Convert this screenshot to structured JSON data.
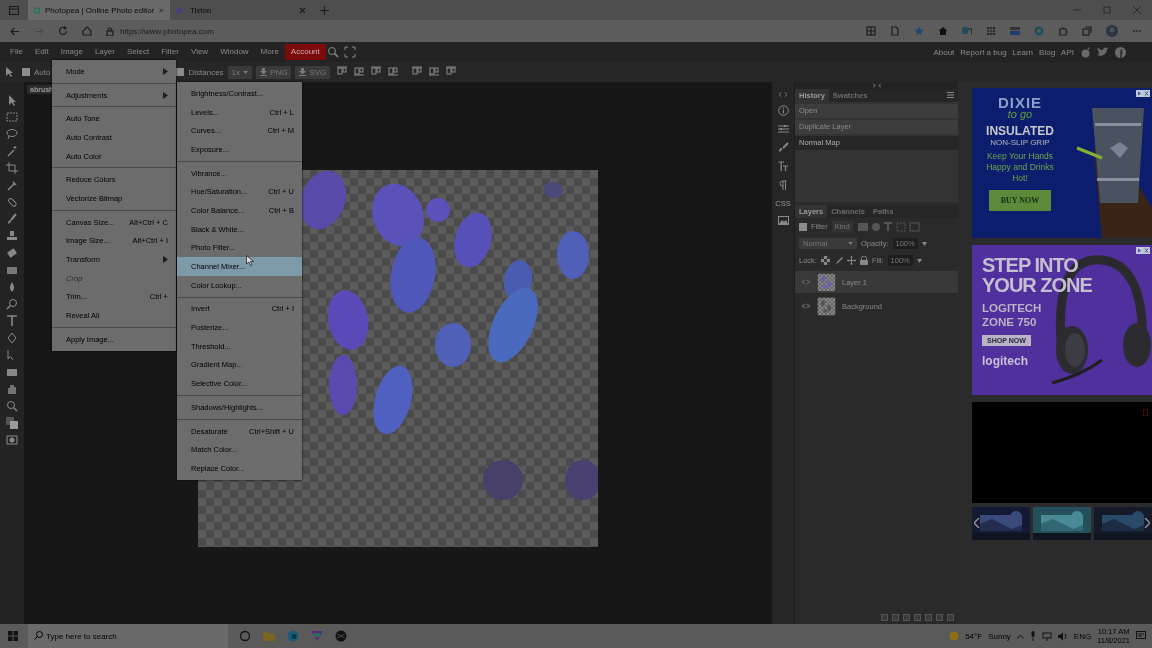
{
  "browser": {
    "tabs": [
      {
        "title": "Photopea | Online Photo editor",
        "selected": true
      },
      {
        "title": "Tixton",
        "selected": false
      }
    ],
    "url": "https://www.photopea.com"
  },
  "menubar": {
    "items": [
      {
        "label": "File",
        "kind": "menu"
      },
      {
        "label": "Edit",
        "kind": "menu"
      },
      {
        "label": "Image",
        "kind": "menu"
      },
      {
        "label": "Layer",
        "kind": "menu"
      },
      {
        "label": "Select",
        "kind": "menu"
      },
      {
        "label": "Filter",
        "kind": "menu"
      },
      {
        "label": "View",
        "kind": "menu"
      },
      {
        "label": "Window",
        "kind": "menu"
      },
      {
        "label": "More",
        "kind": "menu"
      },
      {
        "label": "Account",
        "kind": "account"
      }
    ],
    "links": [
      "About",
      "Report a bug",
      "Learn",
      "Blog",
      "API"
    ]
  },
  "options_bar": {
    "auto_select": {
      "label": "Auto",
      "checked": false
    },
    "distances": {
      "label": "Distances",
      "checked": false
    },
    "scale": "1x",
    "exports": [
      "PNG",
      "SVG"
    ]
  },
  "document_tab": "abrush",
  "image_menu": {
    "groups": [
      [
        {
          "label": "Mode",
          "submenu": true,
          "disabled": false,
          "selected": false
        }
      ],
      [
        {
          "label": "Adjustments",
          "submenu": true,
          "disabled": false,
          "selected": false
        }
      ],
      [
        {
          "label": "Auto Tone",
          "submenu": false,
          "disabled": false,
          "selected": false
        },
        {
          "label": "Auto Contrast",
          "submenu": false,
          "disabled": false,
          "selected": false
        },
        {
          "label": "Auto Color",
          "submenu": false,
          "disabled": false,
          "selected": false
        }
      ],
      [
        {
          "label": "Reduce Colors",
          "submenu": false,
          "disabled": false,
          "selected": false
        },
        {
          "label": "Vectorize Bitmap",
          "submenu": false,
          "disabled": false,
          "selected": false
        }
      ],
      [
        {
          "label": "Canvas Size...",
          "shortcut": "Alt+Ctrl + C",
          "submenu": false,
          "disabled": false,
          "selected": false
        },
        {
          "label": "Image Size...",
          "shortcut": "Alt+Ctrl + I",
          "submenu": false,
          "disabled": false,
          "selected": false
        },
        {
          "label": "Transform",
          "submenu": true,
          "disabled": false,
          "selected": false
        },
        {
          "label": "Crop",
          "submenu": false,
          "disabled": true,
          "selected": false
        },
        {
          "label": "Trim...",
          "shortcut": "Ctrl +",
          "submenu": false,
          "disabled": false,
          "selected": false
        },
        {
          "label": "Reveal All",
          "submenu": false,
          "disabled": false,
          "selected": false
        }
      ],
      [
        {
          "label": "Apply Image...",
          "submenu": false,
          "disabled": false,
          "selected": false
        }
      ]
    ]
  },
  "adjustments_menu": {
    "groups": [
      [
        {
          "label": "Brightness/Contrast...",
          "selected": false
        },
        {
          "label": "Levels...",
          "shortcut": "Ctrl + L",
          "selected": false
        },
        {
          "label": "Curves...",
          "shortcut": "Ctrl + M",
          "selected": false
        },
        {
          "label": "Exposure...",
          "selected": false
        }
      ],
      [
        {
          "label": "Vibrance...",
          "selected": false
        },
        {
          "label": "Hue/Saturation...",
          "shortcut": "Ctrl + U",
          "selected": false
        },
        {
          "label": "Color Balance...",
          "shortcut": "Ctrl + B",
          "selected": false
        },
        {
          "label": "Black & White...",
          "selected": false
        },
        {
          "label": "Photo Filter...",
          "selected": false
        },
        {
          "label": "Channel Mixer...",
          "selected": true
        },
        {
          "label": "Color Lookup...",
          "selected": false
        }
      ],
      [
        {
          "label": "Invert",
          "shortcut": "Ctrl + I",
          "selected": false
        },
        {
          "label": "Posterize...",
          "selected": false
        },
        {
          "label": "Threshold...",
          "selected": false
        },
        {
          "label": "Gradient Map...",
          "selected": false
        },
        {
          "label": "Selective Color...",
          "selected": false
        }
      ],
      [
        {
          "label": "Shadows/Highlights...",
          "selected": false
        }
      ],
      [
        {
          "label": "Desaturate",
          "shortcut": "Ctrl+Shift + U",
          "selected": false
        },
        {
          "label": "Match Color...",
          "selected": false
        },
        {
          "label": "Replace Color...",
          "selected": false
        }
      ]
    ]
  },
  "dock": {
    "css_label": "CSS"
  },
  "history_panel": {
    "tabs": [
      {
        "label": "History",
        "selected": true
      },
      {
        "label": "Swatches",
        "selected": false
      }
    ],
    "items": [
      {
        "label": "Open",
        "selected": false
      },
      {
        "label": "Duplicate Layer",
        "selected": false
      },
      {
        "label": "Normal Map",
        "selected": true
      }
    ]
  },
  "layers_panel": {
    "tabs": [
      {
        "label": "Layers",
        "selected": true
      },
      {
        "label": "Channels",
        "selected": false
      },
      {
        "label": "Paths",
        "selected": false
      }
    ],
    "filter": {
      "label": "Filter",
      "checked": false,
      "kind": "Kind"
    },
    "blend_mode": "Normal",
    "opacity_label": "Opacity:",
    "opacity": "100%",
    "lock_label": "Lock:",
    "fill_label": "Fill:",
    "fill": "100%",
    "layers": [
      {
        "name": "Layer 1",
        "visible": true,
        "selected": true
      },
      {
        "name": "Background",
        "visible": true,
        "selected": false
      }
    ]
  },
  "ads": {
    "dixie": {
      "logo": "DIXIE",
      "tagline": "to go",
      "headline": "INSULATED",
      "subhead": "NON-SLIP GRIP",
      "body": "Keep Your Hands Happy and Drinks Hot!",
      "button": "BUY NOW"
    },
    "logitech": {
      "headline": "STEP INTO YOUR ZONE",
      "product": "LOGITECH ZONE 750",
      "button": "SHOP NOW",
      "brand": "logitech"
    }
  },
  "taskbar": {
    "search_placeholder": "Type here to search",
    "temperature": "54°F",
    "weather": "Sunny",
    "language": "ENG",
    "time": "10:17 AM",
    "date": "11/8/2021"
  }
}
